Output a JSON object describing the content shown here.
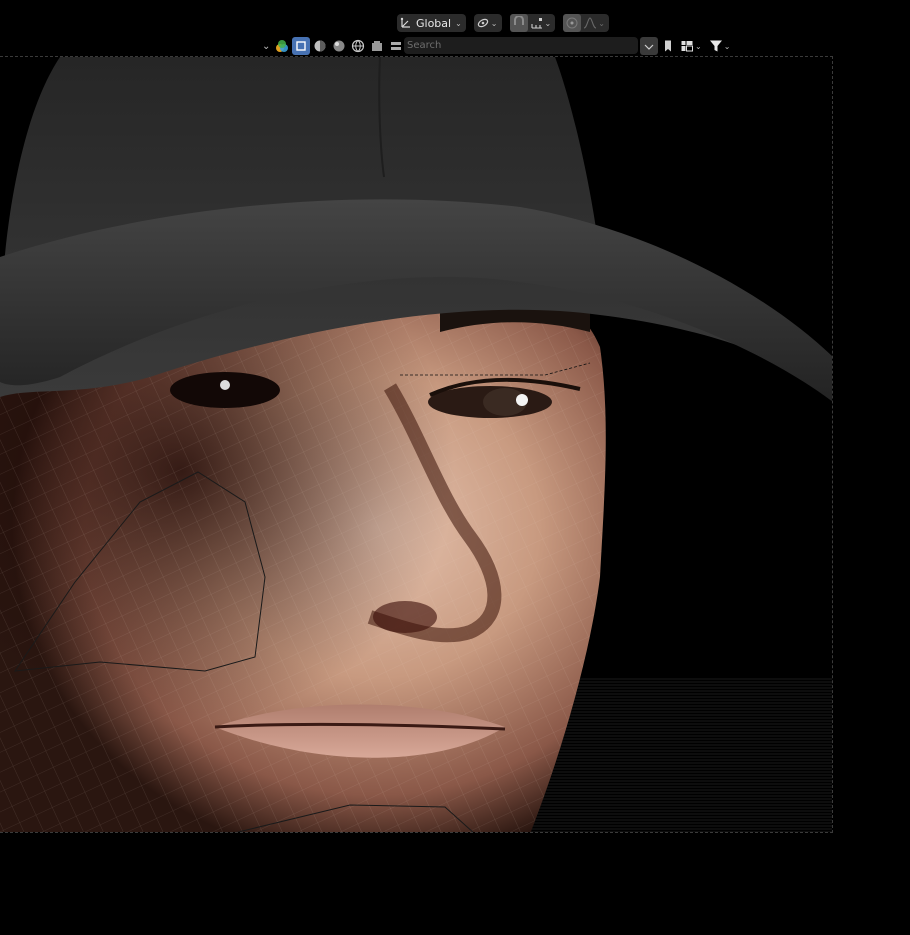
{
  "header": {
    "orientation": {
      "label": "Global",
      "icon": "transform-orientation-icon"
    },
    "pivot": {
      "icon": "pivot-point-icon"
    },
    "snap": {
      "icon": "snap-magnet-icon",
      "target_icon": "snap-increment-icon"
    },
    "proportional_edit": {
      "icon": "proportional-edit-icon",
      "falloff_icon": "falloff-curve-icon"
    }
  },
  "outliner_header": {
    "filter_icons": [
      "display-mode-icon",
      "object-mode-icon",
      "solid-shading-icon",
      "material-shading-icon",
      "rendered-shading-icon",
      "scene-icon",
      "render-layer-icon",
      "output-icon"
    ],
    "search": {
      "placeholder": "Search",
      "value": ""
    },
    "right_icons": [
      "sort-icon",
      "bookmark-icon",
      "view-layout-icon",
      "filter-funnel-icon"
    ]
  },
  "viewport": {
    "content": "3d-render",
    "colors": {
      "background": "#000000",
      "cap": "#2a2a2a",
      "skin": "#c89a80",
      "wire": "#a08878"
    }
  }
}
